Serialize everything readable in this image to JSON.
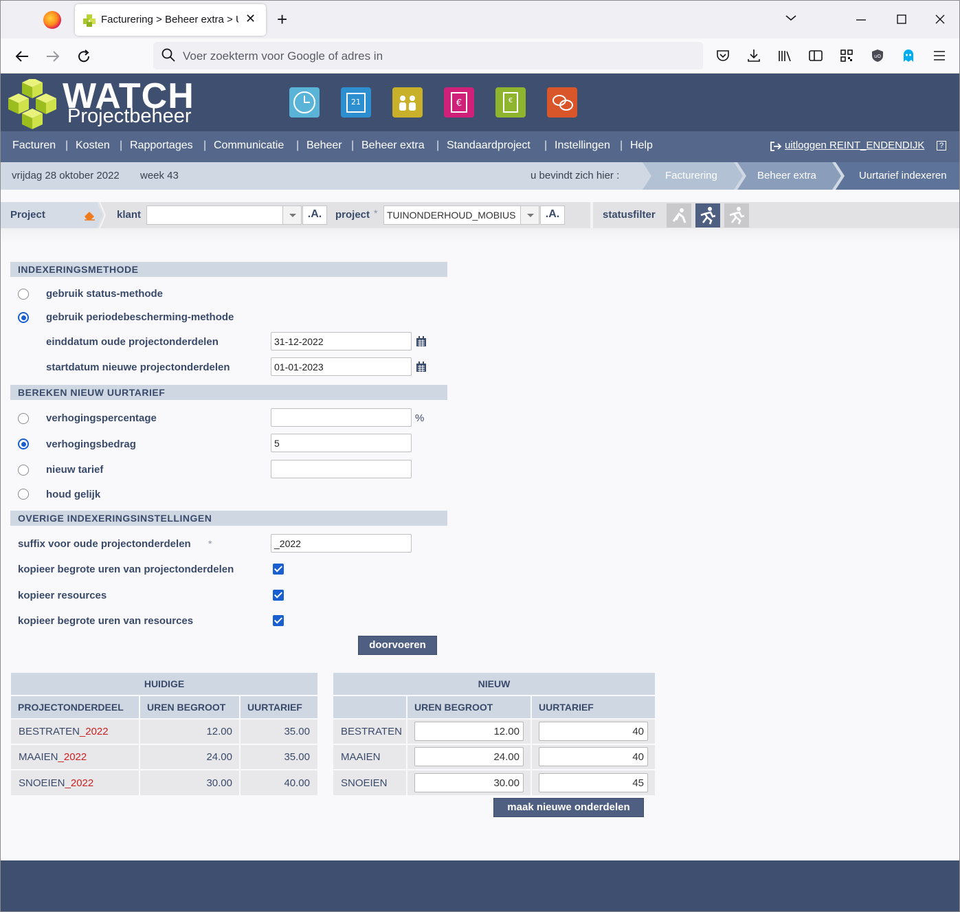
{
  "browser": {
    "tab_title": "Facturering > Beheer extra > Uu",
    "url_placeholder": "Voer zoekterm voor Google of adres in"
  },
  "app": {
    "brand_main": "WATCH",
    "brand_sub": "Projectbeheer",
    "menu": [
      "Facturen",
      "Kosten",
      "Rapportages",
      "Communicatie",
      "Beheer",
      "Beheer extra",
      "Standaardproject",
      "Instellingen",
      "Help"
    ],
    "logout_label": "uitloggen REINT_ENDENDIJK",
    "help_icon": "?"
  },
  "crumbbar": {
    "date": "vrijdag 28 oktober 2022",
    "week": "week 43",
    "here_label": "u bevindt zich hier :",
    "crumbs": [
      "Facturering",
      "Beheer extra",
      "Uurtarief indexeren"
    ]
  },
  "projectbar": {
    "project_label": "Project",
    "klant_label": "klant",
    "klant_value": "",
    "a_label": ".A.",
    "project_field_label": "project",
    "required_mark": "*",
    "project_value": "TUINONDERHOUD_MOBIUS",
    "statusfilter_label": "statusfilter"
  },
  "form": {
    "sec1_title": "INDEXERINGSMETHODE",
    "opt_status": "gebruik status-methode",
    "opt_period": "gebruik periodebescherming-methode",
    "end_label": "einddatum oude projectonderdelen",
    "end_value": "31-12-2022",
    "start_label": "startdatum nieuwe projectonderdelen",
    "start_value": "01-01-2023",
    "sec2_title": "BEREKEN NIEUW UURTARIEF",
    "pct_label": "verhogingspercentage",
    "pct_value": "",
    "pct_unit": "%",
    "amt_label": "verhogingsbedrag",
    "amt_value": "5",
    "new_label": "nieuw tarief",
    "new_value": "",
    "same_label": "houd gelijk",
    "sec3_title": "OVERIGE INDEXERINGSINSTELLINGEN",
    "suffix_label": "suffix voor oude projectonderdelen",
    "suffix_value": "_2022",
    "copy_hours_label": "kopieer begrote uren van projectonderdelen",
    "copy_res_label": "kopieer resources",
    "copy_res_hours_label": "kopieer begrote uren van resources",
    "submit_label": "doorvoeren"
  },
  "tables": {
    "current_title": "HUIDIGE",
    "new_title": "NIEUW",
    "col_part": "PROJECTONDERDEEL",
    "col_hours": "UREN BEGROOT",
    "col_rate": "UURTARIEF",
    "current_rows": [
      {
        "name": "BESTRATEN",
        "suffix": "_2022",
        "hours": "12.00",
        "rate": "35.00"
      },
      {
        "name": "MAAIEN",
        "suffix": "_2022",
        "hours": "24.00",
        "rate": "35.00"
      },
      {
        "name": "SNOEIEN",
        "suffix": "_2022",
        "hours": "30.00",
        "rate": "40.00"
      }
    ],
    "new_rows": [
      {
        "name": "BESTRATEN",
        "hours": "12.00",
        "rate": "40"
      },
      {
        "name": "MAAIEN",
        "hours": "24.00",
        "rate": "40"
      },
      {
        "name": "SNOEIEN",
        "hours": "30.00",
        "rate": "45"
      }
    ],
    "create_label": "maak nieuwe onderdelen"
  }
}
